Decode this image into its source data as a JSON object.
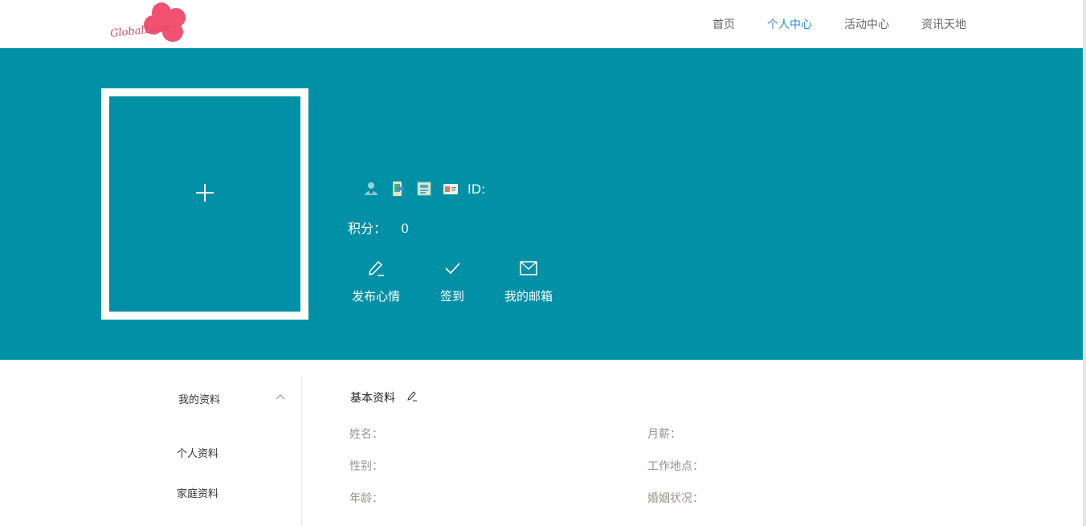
{
  "header": {
    "logo_text": "GlobalLove",
    "nav": [
      "首页",
      "个人中心",
      "活动中心",
      "资讯天地"
    ],
    "active_index": 1,
    "colors": {
      "active": "#2a8bd6",
      "normal": "#666666",
      "logo_petal": "#f0526f"
    }
  },
  "hero": {
    "background": "#0290a6",
    "avatar_icon": "plus-icon",
    "badge_icons": [
      "verified-user-icon",
      "phone-verified-icon",
      "education-verified-icon",
      "id-card-icon"
    ],
    "id_label": "ID:",
    "points_label": "积分：",
    "points_value": "0",
    "actions": [
      {
        "label": "发布心情",
        "icon": "pencil-icon"
      },
      {
        "label": "签到",
        "icon": "check-icon"
      },
      {
        "label": "我的邮箱",
        "icon": "mail-icon"
      }
    ]
  },
  "sidebar": {
    "title": "我的资料",
    "items": [
      "个人资料",
      "家庭资料"
    ]
  },
  "profile": {
    "section_title": "基本资料",
    "left_fields": [
      "姓名：",
      "性别：",
      "年龄："
    ],
    "right_fields": [
      "月薪：",
      "工作地点：",
      "婚姻状况："
    ]
  }
}
